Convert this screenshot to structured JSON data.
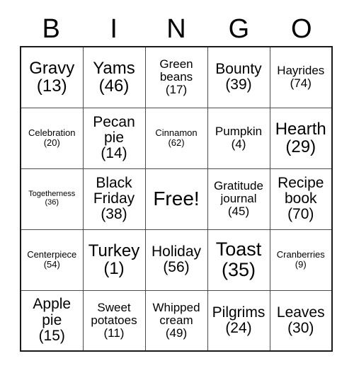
{
  "card": {
    "title_letters": [
      "B",
      "I",
      "N",
      "G",
      "O"
    ],
    "free_space_label": "Free!",
    "colors": {
      "background": "#ffffff",
      "text": "#000000",
      "outer_border": "#1a1a1a",
      "inner_border": "#4d4d4d"
    },
    "rows": [
      [
        {
          "label": "Gravy",
          "number": "(13)",
          "size": "lg"
        },
        {
          "label": "Yams",
          "number": "(46)",
          "size": "lg"
        },
        {
          "label": "Green beans",
          "number": "(17)",
          "size": "sm"
        },
        {
          "label": "Bounty",
          "number": "(39)",
          "size": "md"
        },
        {
          "label": "Hayrides",
          "number": "(74)",
          "size": "sm"
        }
      ],
      [
        {
          "label": "Celebration",
          "number": "(20)",
          "size": "xs"
        },
        {
          "label": "Pecan pie",
          "number": "(14)",
          "size": "md"
        },
        {
          "label": "Cinnamon",
          "number": "(62)",
          "size": "xs"
        },
        {
          "label": "Pumpkin",
          "number": "(4)",
          "size": "sm"
        },
        {
          "label": "Hearth",
          "number": "(29)",
          "size": "lg"
        }
      ],
      [
        {
          "label": "Togetherness",
          "number": "(36)",
          "size": "xxs"
        },
        {
          "label": "Black Friday",
          "number": "(38)",
          "size": "md"
        },
        {
          "label": "Free!",
          "number": "",
          "size": "free"
        },
        {
          "label": "Gratitude journal",
          "number": "(45)",
          "size": "sm"
        },
        {
          "label": "Recipe book",
          "number": "(70)",
          "size": "md"
        }
      ],
      [
        {
          "label": "Centerpiece",
          "number": "(54)",
          "size": "xs"
        },
        {
          "label": "Turkey",
          "number": "(1)",
          "size": "lg"
        },
        {
          "label": "Holiday",
          "number": "(56)",
          "size": "md"
        },
        {
          "label": "Toast",
          "number": "(35)",
          "size": "xl"
        },
        {
          "label": "Cranberries",
          "number": "(9)",
          "size": "xs"
        }
      ],
      [
        {
          "label": "Apple pie",
          "number": "(15)",
          "size": "md"
        },
        {
          "label": "Sweet potatoes",
          "number": "(11)",
          "size": "sm"
        },
        {
          "label": "Whipped cream",
          "number": "(49)",
          "size": "sm"
        },
        {
          "label": "Pilgrims",
          "number": "(24)",
          "size": "md"
        },
        {
          "label": "Leaves",
          "number": "(30)",
          "size": "md"
        }
      ]
    ]
  }
}
